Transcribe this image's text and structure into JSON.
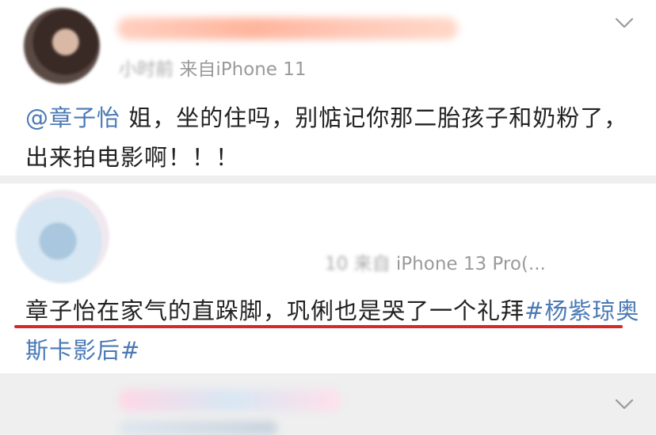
{
  "post1": {
    "meta_time_blurred": "小时前",
    "meta_source": "来自iPhone 11",
    "mention": "@章子怡",
    "text": " 姐，坐的住吗，别惦记你那二胎孩子和奶粉了，出来拍电影啊！！！"
  },
  "post2": {
    "meta_time_blurred": "10",
    "meta_source_blurred": "来自",
    "meta_source": "iPhone 13 Pro(...",
    "text": "章子怡在家气的直跺脚，巩俐也是哭了一个礼拜",
    "hashtag": "#杨紫琼奥斯卡影后#"
  },
  "colors": {
    "link": "#4a79b5",
    "meta": "#9a9a9a",
    "underline": "#d42a2a"
  },
  "icons": [
    "chevron-down-icon",
    "chevron-down-icon"
  ]
}
